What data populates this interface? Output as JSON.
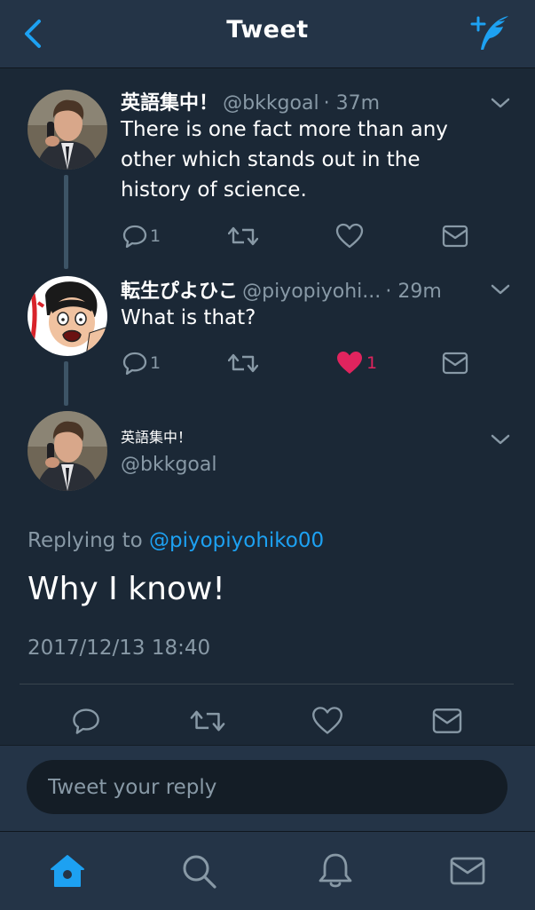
{
  "header": {
    "title": "Tweet",
    "back_icon": "chevron-left-icon",
    "compose_icon": "compose-tweet-icon"
  },
  "colors": {
    "accent": "#1da1f2",
    "like": "#e0245e",
    "muted": "#8899a6",
    "background": "#1b2836",
    "bar": "#243447"
  },
  "thread": [
    {
      "name": "英語集中！",
      "handle": "@bkkgoal",
      "time": "· 37m",
      "text_lines": [
        "There is one fact more than any",
        "other which stands out in the",
        "history of science."
      ],
      "reply_count": "1",
      "like_count": ""
    },
    {
      "name": "転生ぴよひこ",
      "handle": "@piyopiyohi...",
      "time": "· 29m",
      "text_lines": [
        "What is that?"
      ],
      "reply_count": "1",
      "like_count": "1"
    }
  ],
  "focused": {
    "name": "英語集中！",
    "handle": "@bkkgoal",
    "replying_prefix": "Replying to",
    "replying_to": "@piyopiyohiko00",
    "text": "Why I know!",
    "timestamp": "2017/12/13 18:40"
  },
  "reply_box": {
    "placeholder": "Tweet your reply"
  },
  "tabbar": {
    "items": [
      "home-icon",
      "search-icon",
      "notifications-icon",
      "messages-icon"
    ]
  }
}
